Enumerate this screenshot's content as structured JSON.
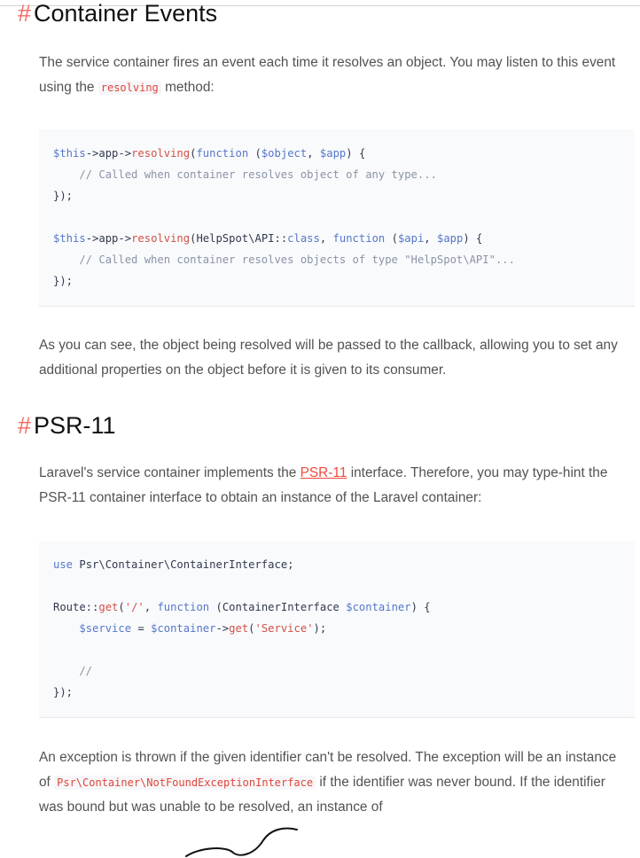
{
  "section1": {
    "hash": "#",
    "title": "Container Events",
    "intro_before": "The service container fires an event each time it resolves an object. You may listen to this event using the",
    "intro_code": "resolving",
    "intro_after": "method:",
    "code_lines": [
      "$this->app->resolving(function ($object, $app) {",
      "    // Called when container resolves object of any type...",
      "});",
      "",
      "$this->app->resolving(HelpSpot\\API::class, function ($api, $app) {",
      "    // Called when container resolves objects of type \"HelpSpot\\API\"...",
      "});"
    ],
    "outro": "As you can see, the object being resolved will be passed to the callback, allowing you to set any additional properties on the object before it is given to its consumer."
  },
  "section2": {
    "hash": "#",
    "title": "PSR-11",
    "intro_before": "Laravel's service container implements the",
    "intro_link": "PSR-11",
    "intro_after": "interface. Therefore, you may type-hint the PSR-11 container interface to obtain an instance of the Laravel container:",
    "code_lines": [
      "use Psr\\Container\\ContainerInterface;",
      "",
      "Route::get('/', function (ContainerInterface $container) {",
      "    $service = $container->get('Service');",
      "",
      "    //",
      "});"
    ],
    "outro_before": "An exception is thrown if the given identifier can't be resolved. The exception will be an instance of",
    "outro_code": "Psr\\Container\\NotFoundExceptionInterface",
    "outro_after": "if the identifier was never bound. If the identifier was bound but was unable to be resolved, an instance of"
  }
}
